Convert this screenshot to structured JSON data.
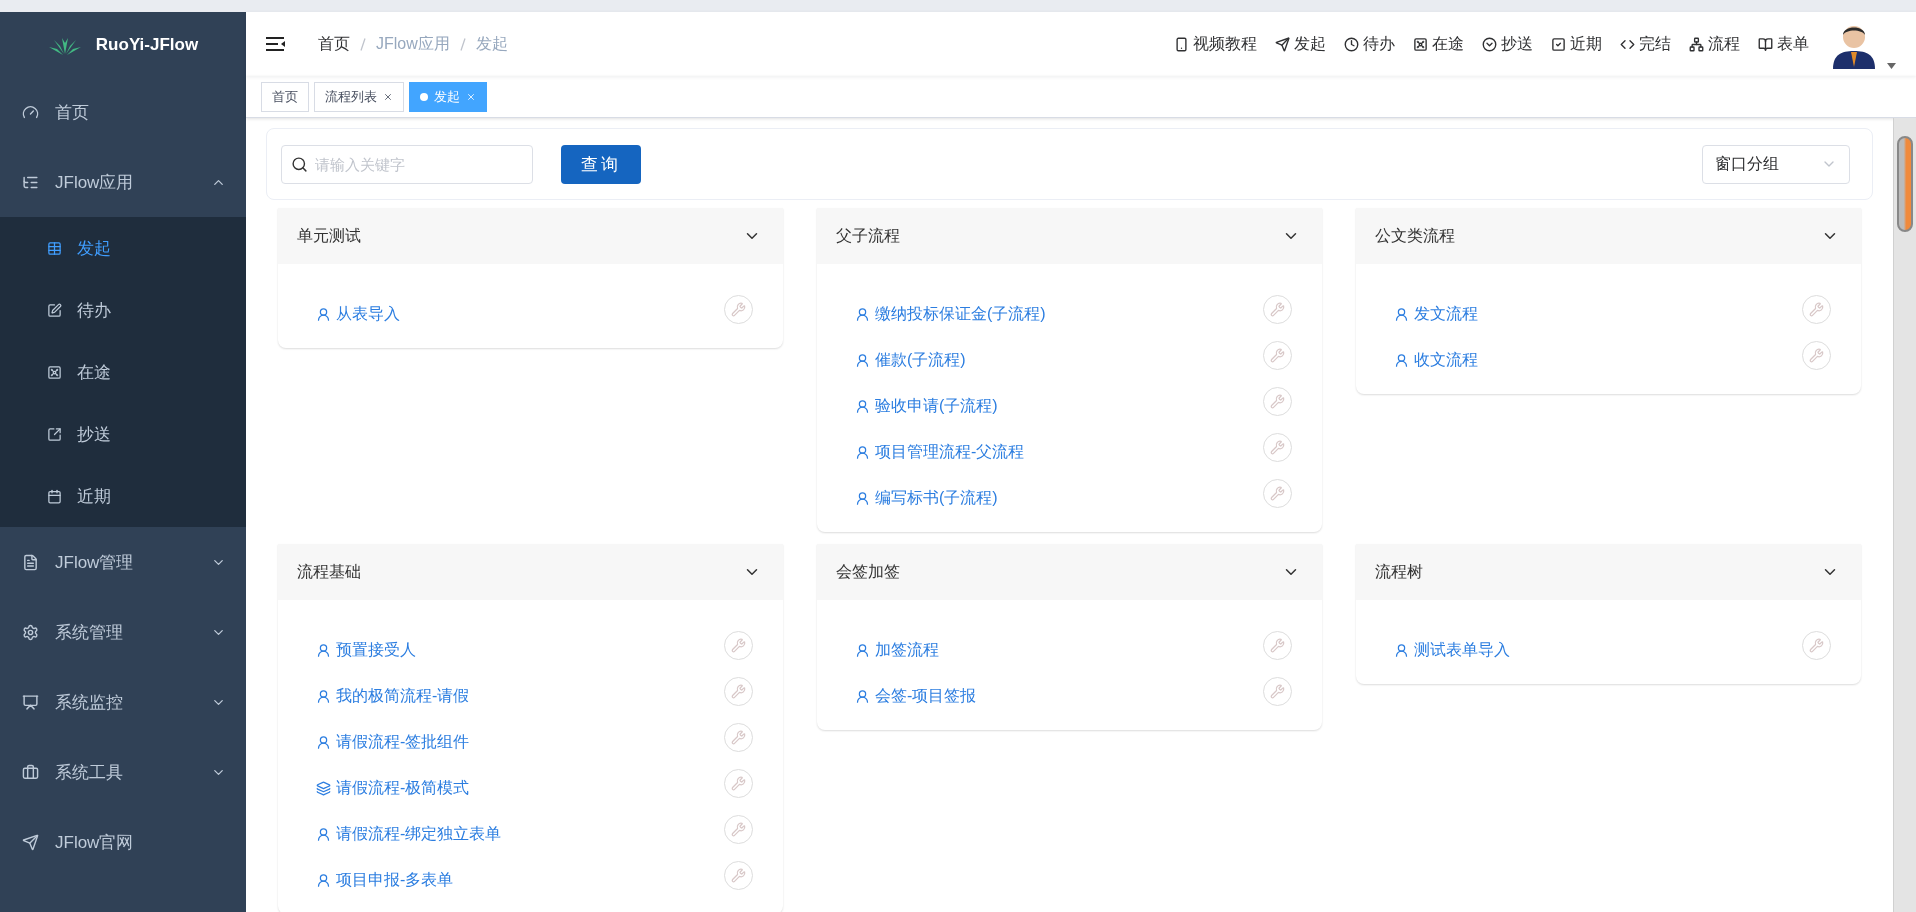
{
  "sidebar": {
    "logo": "RuoYi-JFlow",
    "items": [
      {
        "label": "首页",
        "selected": false
      },
      {
        "label": "JFlow应用",
        "selected": false,
        "expanded": true,
        "children": [
          {
            "label": "发起",
            "selected": true
          },
          {
            "label": "待办",
            "selected": false
          },
          {
            "label": "在途",
            "selected": false
          },
          {
            "label": "抄送",
            "selected": false
          },
          {
            "label": "近期",
            "selected": false
          }
        ]
      },
      {
        "label": "JFlow管理",
        "selected": false,
        "expanded": false
      },
      {
        "label": "系统管理",
        "selected": false,
        "expanded": false
      },
      {
        "label": "系统监控",
        "selected": false,
        "expanded": false
      },
      {
        "label": "系统工具",
        "selected": false,
        "expanded": false
      },
      {
        "label": "JFlow官网",
        "selected": false
      }
    ]
  },
  "breadcrumb": [
    "首页",
    "JFlow应用",
    "发起"
  ],
  "top_links": [
    "视频教程",
    "发起",
    "待办",
    "在途",
    "抄送",
    "近期",
    "完结",
    "流程",
    "表单"
  ],
  "tags": [
    {
      "label": "首页",
      "selected": false,
      "closable": false
    },
    {
      "label": "流程列表",
      "selected": false,
      "closable": true
    },
    {
      "label": "发起",
      "selected": true,
      "closable": true
    }
  ],
  "search": {
    "placeholder": "请输入关键字",
    "button": "查询",
    "group_select": "窗口分组"
  },
  "groups": [
    {
      "title": "单元测试",
      "items": [
        {
          "label": "从表导入",
          "kind": "flow"
        }
      ]
    },
    {
      "title": "父子流程",
      "items": [
        {
          "label": "缴纳投标保证金(子流程)",
          "kind": "flow"
        },
        {
          "label": "催款(子流程)",
          "kind": "flow"
        },
        {
          "label": "验收申请(子流程)",
          "kind": "flow"
        },
        {
          "label": "项目管理流程-父流程",
          "kind": "flow"
        },
        {
          "label": "编写标书(子流程)",
          "kind": "flow"
        }
      ]
    },
    {
      "title": "公文类流程",
      "items": [
        {
          "label": "发文流程",
          "kind": "flow"
        },
        {
          "label": "收文流程",
          "kind": "flow"
        }
      ]
    },
    {
      "title": "流程基础",
      "items": [
        {
          "label": "预置接受人",
          "kind": "flow"
        },
        {
          "label": "我的极简流程-请假",
          "kind": "flow"
        },
        {
          "label": "请假流程-签批组件",
          "kind": "flow"
        },
        {
          "label": "请假流程-极简模式",
          "kind": "simple"
        },
        {
          "label": "请假流程-绑定独立表单",
          "kind": "flow"
        },
        {
          "label": "项目申报-多表单",
          "kind": "flow"
        }
      ]
    },
    {
      "title": "会签加签",
      "items": [
        {
          "label": "加签流程",
          "kind": "flow"
        },
        {
          "label": "会签-项目签报",
          "kind": "flow"
        }
      ]
    },
    {
      "title": "流程树",
      "items": [
        {
          "label": "测试表单导入",
          "kind": "flow"
        }
      ]
    }
  ]
}
